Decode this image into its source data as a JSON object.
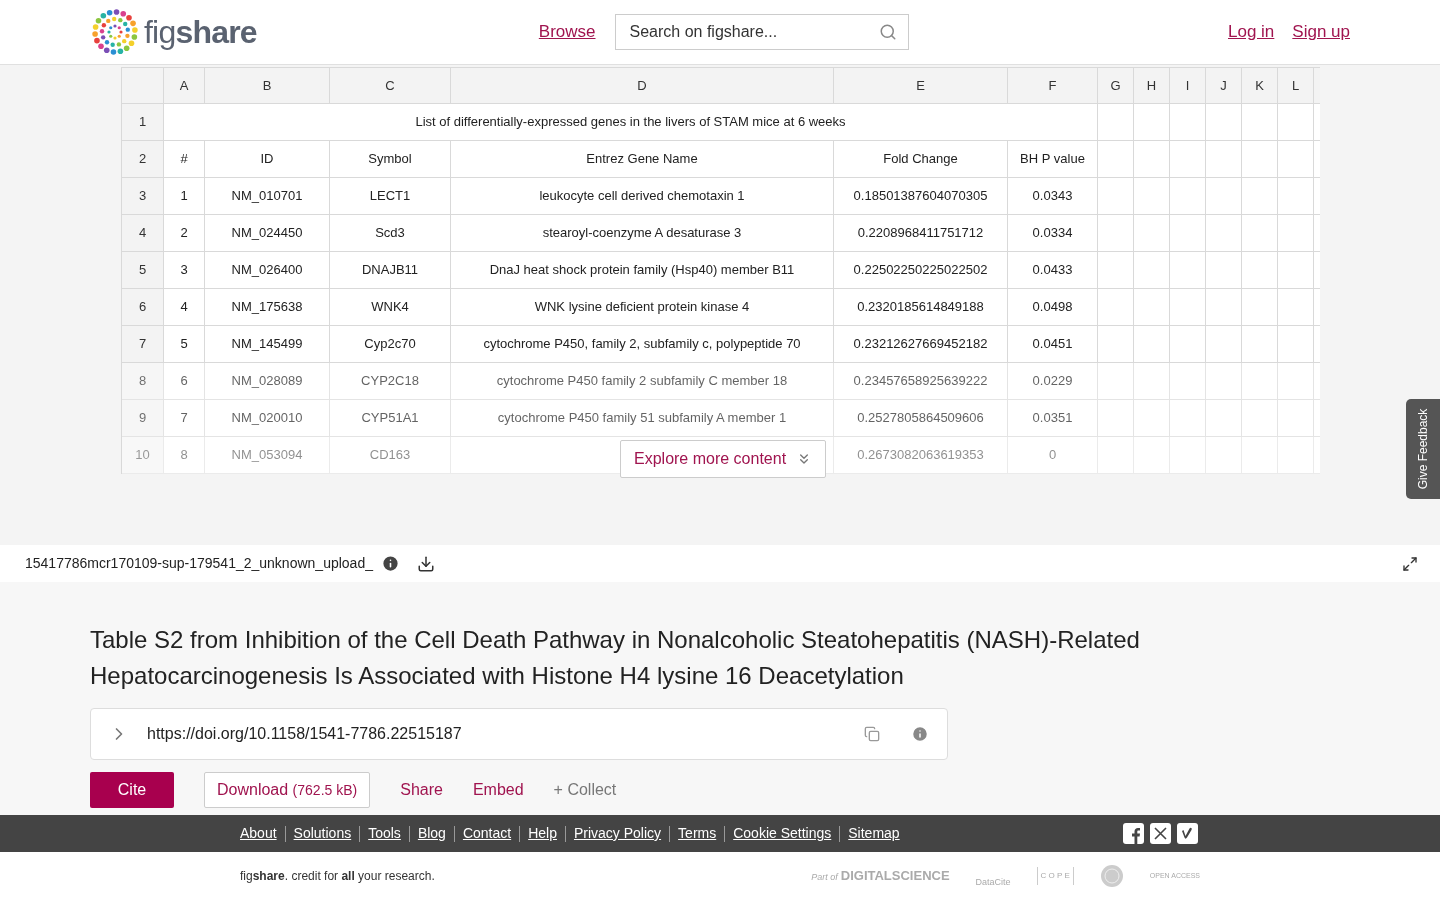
{
  "header": {
    "logo_text": "fig**share**",
    "browse": "Browse",
    "search": {
      "placeholder": "Search on figshare..."
    },
    "auth_links": [
      "Log in",
      "Sign up"
    ]
  },
  "spreadsheet": {
    "columns": [
      "A",
      "B",
      "C",
      "D",
      "E",
      "F",
      "G",
      "H",
      "I",
      "J",
      "K",
      "L"
    ],
    "rows": [
      {
        "number": "1",
        "kind": "merged",
        "text": "List of differentially-expressed genes in the livers of STAM mice at 6 weeks"
      },
      {
        "number": "2",
        "kind": "cells",
        "cells": [
          "#",
          "ID",
          "Symbol",
          "Entrez Gene Name",
          "Fold Change",
          "BH P value"
        ]
      },
      {
        "number": "3",
        "kind": "cells",
        "cells": [
          "1",
          "NM_010701",
          "LECT1",
          "leukocyte cell derived chemotaxin 1",
          "0.18501387604070305",
          "0.0343"
        ]
      },
      {
        "number": "4",
        "kind": "cells",
        "cells": [
          "2",
          "NM_024450",
          "Scd3",
          "stearoyl-coenzyme A desaturase 3",
          "0.2208968411751712",
          "0.0334"
        ]
      },
      {
        "number": "5",
        "kind": "cells",
        "cells": [
          "3",
          "NM_026400",
          "DNAJB11",
          "DnaJ heat shock protein family (Hsp40) member B11",
          "0.22502250225022502",
          "0.0433"
        ]
      },
      {
        "number": "6",
        "kind": "cells",
        "cells": [
          "4",
          "NM_175638",
          "WNK4",
          "WNK lysine deficient protein kinase 4",
          "0.2320185614849188",
          "0.0498"
        ]
      },
      {
        "number": "7",
        "kind": "cells",
        "cells": [
          "5",
          "NM_145499",
          "Cyp2c70",
          "cytochrome P450, family 2, subfamily c, polypeptide 70",
          "0.23212627669452182",
          "0.0451"
        ]
      },
      {
        "number": "8",
        "kind": "faded",
        "cells": [
          "6",
          "NM_028089",
          "CYP2C18",
          "cytochrome P450 family 2 subfamily C member 18",
          "0.23457658925639222",
          "0.0229"
        ]
      },
      {
        "number": "9",
        "kind": "faded",
        "cells": [
          "7",
          "NM_020010",
          "CYP51A1",
          "cytochrome P450 family 51 subfamily A member 1",
          "0.2527805864509606",
          "0.0351"
        ]
      },
      {
        "number": "10",
        "kind": "faint",
        "cells": [
          "8",
          "NM_053094",
          "CD163",
          "",
          "0.2673082063619353",
          "0"
        ]
      }
    ]
  },
  "explore_button": "Explore more content",
  "feedback_tab": "Give Feedback",
  "file": {
    "name": "15417786mcr170109-sup-179541_2_unknown_upload_"
  },
  "title": "Table S2 from Inhibition of the Cell Death Pathway in Nonalcoholic Steatohepatitis (NASH)-Related Hepatocarcinogenesis Is Associated with Histone H4 lysine 16 Deacetylation",
  "doi": "https://doi.org/10.1158/1541-7786.22515187",
  "actions": {
    "cite": "Cite",
    "download": "Download",
    "download_size": "(762.5 kB)",
    "share": "Share",
    "embed": "Embed",
    "collect": "+ Collect"
  },
  "footer": {
    "links": [
      "About",
      "Solutions",
      "Tools",
      "Blog",
      "Contact",
      "Help",
      "Privacy Policy",
      "Terms",
      "Cookie Settings",
      "Sitemap"
    ],
    "tagline": "fig**share**. credit for **all** your research.",
    "partners": {
      "part_of": "Part of",
      "digital_science": "DIGITALSCIENCE",
      "datacite": "DataCite",
      "cope": "C O P E",
      "open_access": "OPEN ACCESS"
    }
  }
}
